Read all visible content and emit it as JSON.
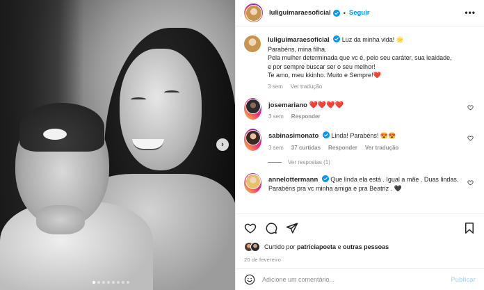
{
  "colors": {
    "accent": "#0095f6",
    "heart": "#ed4956",
    "muted": "#8e8e8e",
    "text": "#262626"
  },
  "header": {
    "username": "luliguimaraesoficial",
    "bullet": "•",
    "follow_label": "Seguir",
    "more_label": "•••"
  },
  "caption": {
    "username": "luliguimaraesoficial",
    "lines": [
      "Luz da minha vida! 🌟",
      "Parabéns, mina filha.",
      "Pela mulher determinada que vc é, pelo seu caráter, sua lealdade,",
      "e por sempre buscar ser o seu melhor!",
      "Te amo, meu kkinho. Muito e Sempre!❤️"
    ],
    "time": "3 sem",
    "translate": "Ver tradução"
  },
  "comments": [
    {
      "username": "josemariano",
      "text": "❤️❤️❤️❤️",
      "time": "3 sem",
      "reply": "Responder"
    },
    {
      "username": "sabinasimonato",
      "text": "Linda! Parabéns! 😍😍",
      "time": "3 sem",
      "likes": "37 curtidas",
      "reply": "Responder",
      "translate": "Ver tradução",
      "view_replies": "Ver respostas (1)"
    },
    {
      "username": "annelottermann",
      "text": "Que linda ela está . Igual a mãe . Duas lindas. Parabéns pra vc minha amiga e pra Beatriz . 🖤"
    }
  ],
  "likes": {
    "prefix": "Curtido por",
    "user": "patriciapoeta",
    "middle": "e",
    "others": "outras pessoas"
  },
  "date": "20 de fevereiro",
  "add_comment": {
    "placeholder": "Adicione um comentário...",
    "publish_label": "Publicar"
  },
  "icons": {
    "next": "chevron-right-icon",
    "like": "heart-icon",
    "comment": "comment-icon",
    "share": "send-icon",
    "save": "bookmark-icon",
    "emoji": "smiley-icon"
  },
  "carousel": {
    "total": 8,
    "active": 1
  }
}
